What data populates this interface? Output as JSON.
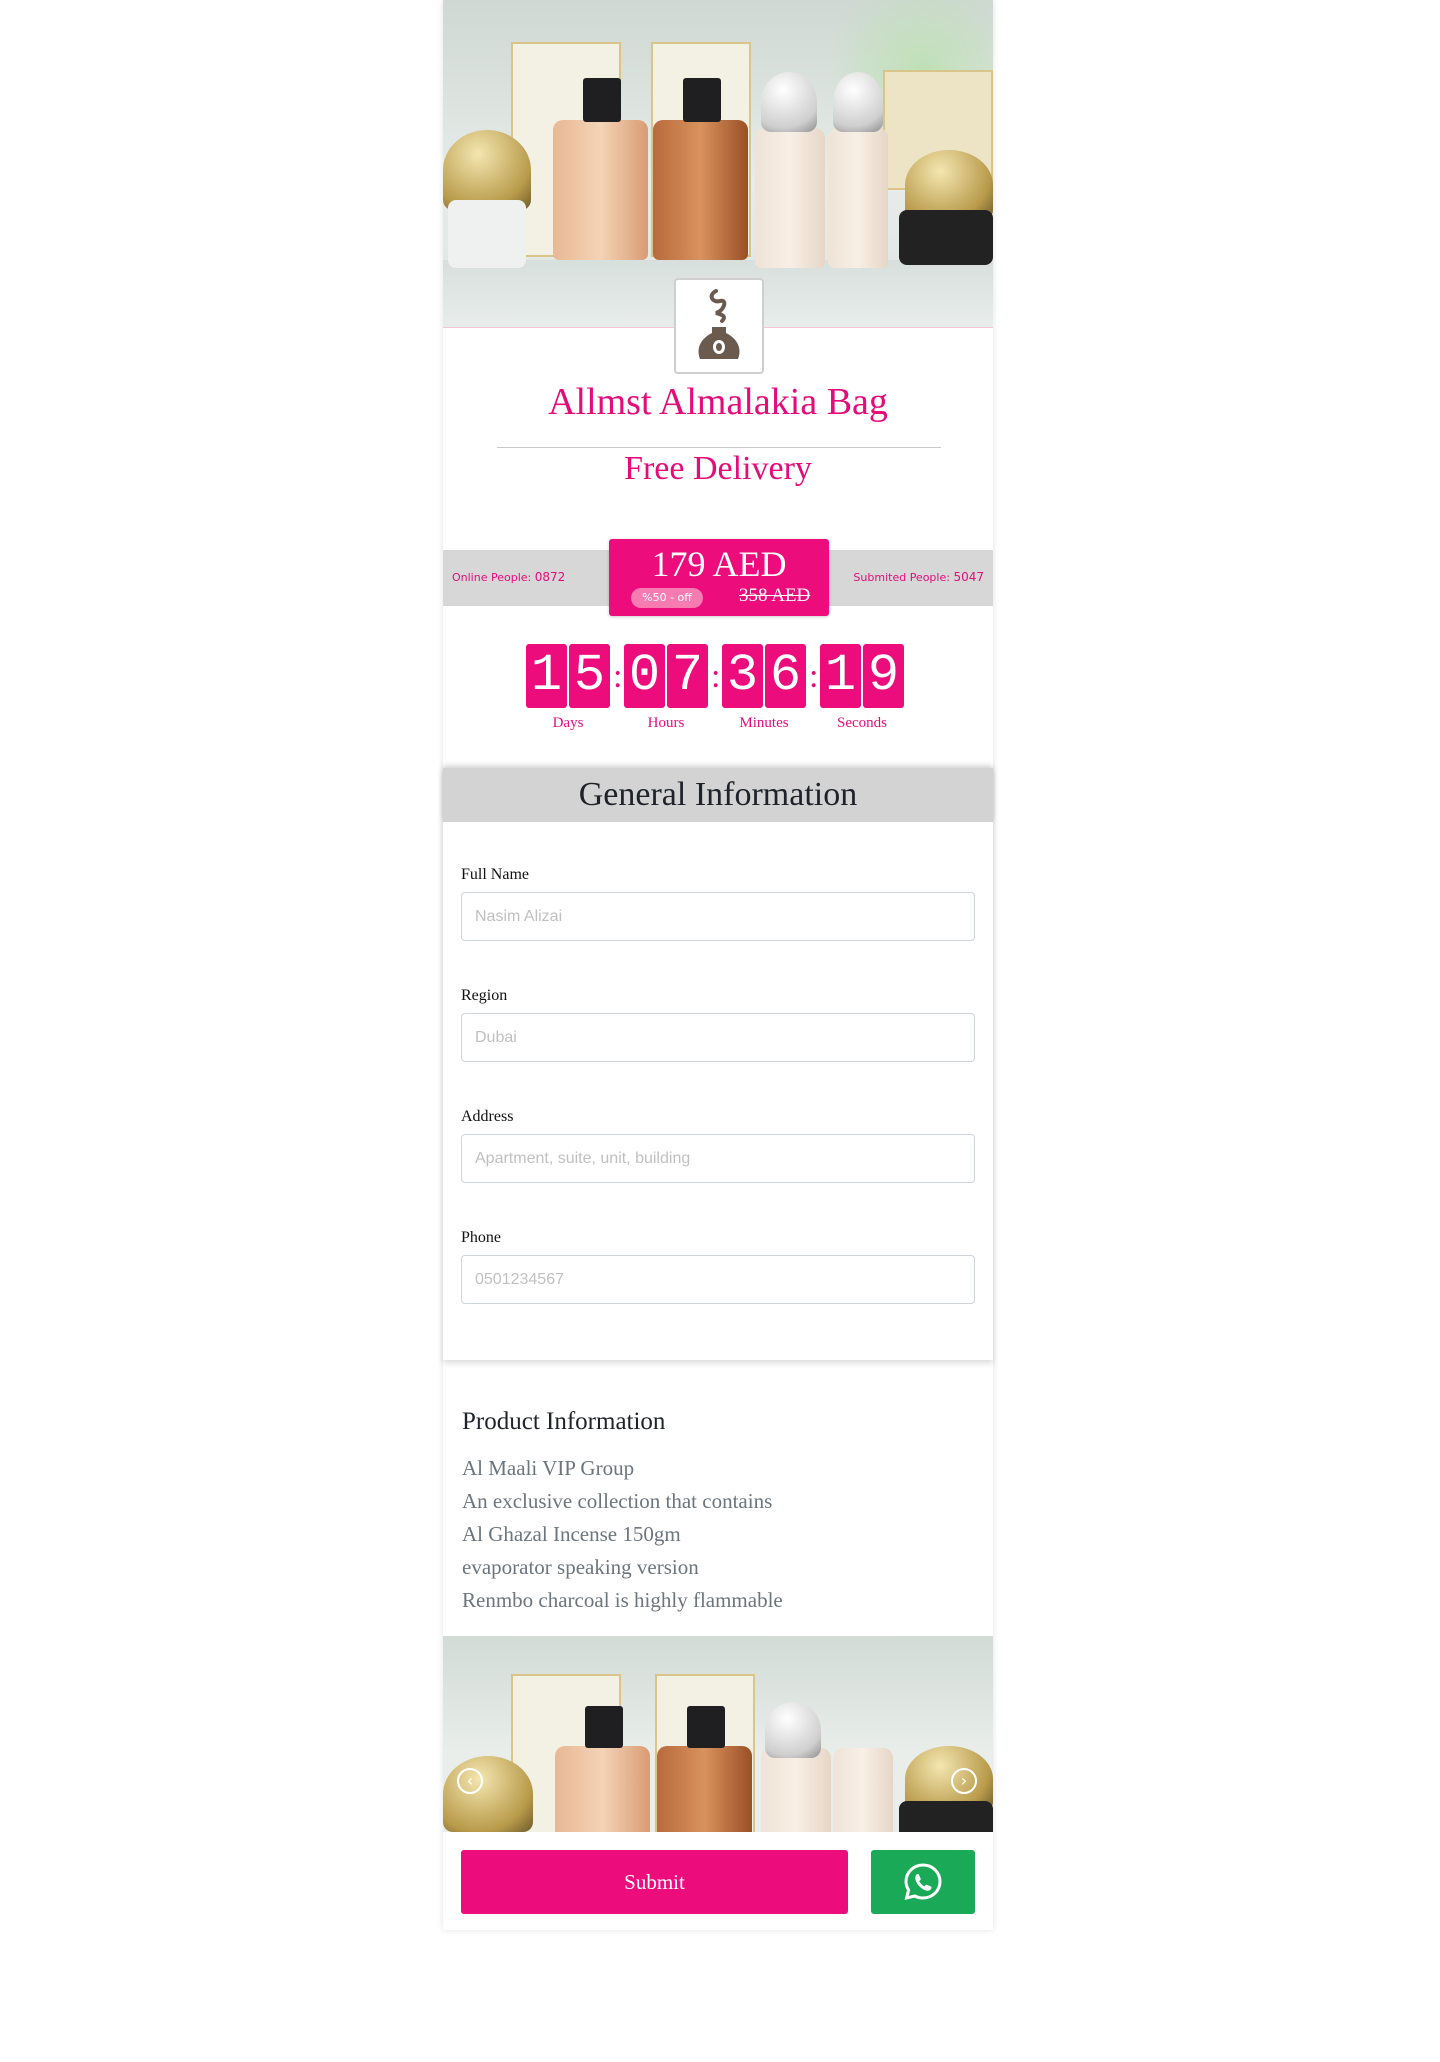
{
  "product": {
    "title": "Allmst Almalakia Bag",
    "delivery": "Free Delivery"
  },
  "pricing": {
    "online_label": "Online People:",
    "online_count": "0872",
    "submitted_label": "Submited People:",
    "submitted_count": "5047",
    "price": "179 AED",
    "discount_badge": "%50 - off",
    "old_price": "358 AED"
  },
  "countdown": {
    "days": [
      "1",
      "5"
    ],
    "hours": [
      "0",
      "7"
    ],
    "minutes": [
      "3",
      "6"
    ],
    "seconds": [
      "1",
      "9"
    ],
    "labels": {
      "days": "Days",
      "hours": "Hours",
      "minutes": "Minutes",
      "seconds": "Seconds"
    },
    "separator": ":"
  },
  "form": {
    "heading": "General Information",
    "fields": [
      {
        "label": "Full Name",
        "placeholder": "Nasim Alizai"
      },
      {
        "label": "Region",
        "placeholder": "Dubai"
      },
      {
        "label": "Address",
        "placeholder": "Apartment, suite, unit, building"
      },
      {
        "label": "Phone",
        "placeholder": "0501234567"
      }
    ]
  },
  "product_info": {
    "heading": "Product Information",
    "lines": [
      "Al Maali VIP Group",
      "An exclusive collection that contains",
      "Al Ghazal Incense 150gm",
      "evaporator speaking version",
      "Renmbo charcoal is highly flammable"
    ]
  },
  "carousel": {
    "prev_icon": "chevron-left-icon",
    "next_icon": "chevron-right-icon"
  },
  "actions": {
    "submit_label": "Submit",
    "whatsapp_icon": "whatsapp-icon"
  },
  "colors": {
    "brand": "#ec0c7b",
    "whatsapp": "#1aaa57",
    "header_gray": "#d3d3d3"
  }
}
